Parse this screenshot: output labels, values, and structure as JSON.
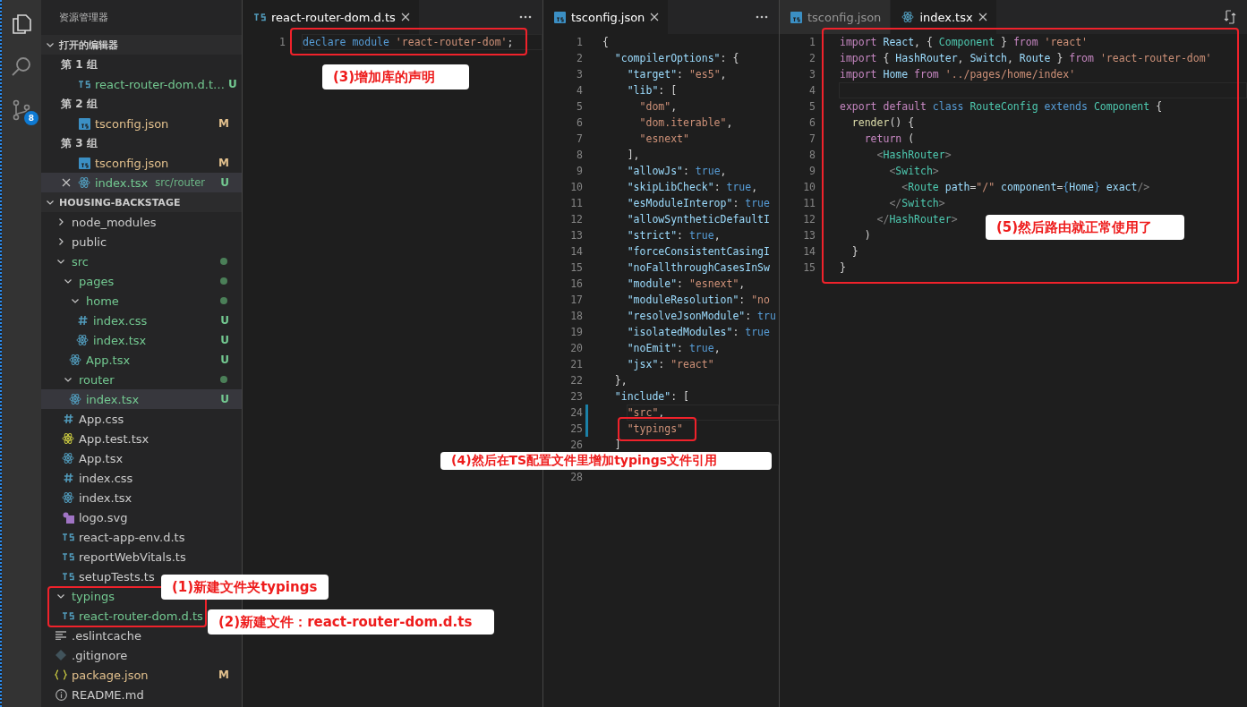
{
  "activity_bar": {
    "badge": "8"
  },
  "explorer": {
    "title": "资源管理器",
    "open_editors": {
      "title": "打开的编辑器",
      "expanded": true,
      "groups": [
        {
          "label": "第 1 组",
          "files": [
            {
              "name": "react-router-dom.d.t…",
              "kind": "ts",
              "color": "#73c991",
              "badge": "U",
              "selected": false
            }
          ]
        },
        {
          "label": "第 2 组",
          "files": [
            {
              "name": "tsconfig.json",
              "kind": "tsconfig",
              "color": "#e2c08d",
              "badge": "M",
              "selected": false
            }
          ]
        },
        {
          "label": "第 3 组",
          "files": [
            {
              "name": "tsconfig.json",
              "kind": "tsconfig",
              "color": "#e2c08d",
              "badge": "M",
              "selected": false
            },
            {
              "name": "index.tsx",
              "description": "src/router",
              "kind": "react",
              "color": "#73c991",
              "badge": "U",
              "selected": true
            }
          ]
        }
      ]
    },
    "project": {
      "title": "HOUSING-BACKSTAGE",
      "expanded": true,
      "tree": [
        {
          "name": "node_modules",
          "kind": "folder",
          "expanded": false,
          "color": "#cccccc",
          "selected": false
        },
        {
          "name": "public",
          "kind": "folder",
          "expanded": false,
          "color": "#cccccc",
          "selected": false
        },
        {
          "name": "src",
          "kind": "folder",
          "expanded": true,
          "color": "#73c991",
          "dot": true,
          "selected": false,
          "children": [
            {
              "name": "pages",
              "kind": "folder",
              "expanded": true,
              "color": "#73c991",
              "dot": true,
              "selected": false,
              "children": [
                {
                  "name": "home",
                  "kind": "folder",
                  "expanded": true,
                  "color": "#73c991",
                  "dot": true,
                  "selected": false,
                  "children": [
                    {
                      "name": "index.css",
                      "kind": "css",
                      "color": "#73c991",
                      "badge": "U",
                      "selected": false
                    },
                    {
                      "name": "index.tsx",
                      "kind": "react",
                      "color": "#73c991",
                      "badge": "U",
                      "selected": false
                    }
                  ]
                },
                {
                  "name": "App.tsx",
                  "kind": "react",
                  "color": "#73c991",
                  "badge": "U",
                  "selected": false
                }
              ]
            },
            {
              "name": "router",
              "kind": "folder",
              "expanded": true,
              "color": "#73c991",
              "dot": true,
              "selected": false,
              "children": [
                {
                  "name": "index.tsx",
                  "kind": "react",
                  "color": "#73c991",
                  "badge": "U",
                  "selected": true
                }
              ]
            },
            {
              "name": "App.css",
              "kind": "css",
              "color": "#cccccc",
              "selected": false
            },
            {
              "name": "App.test.tsx",
              "kind": "test",
              "color": "#cccccc",
              "selected": false
            },
            {
              "name": "App.tsx",
              "kind": "react",
              "color": "#cccccc",
              "selected": false
            },
            {
              "name": "index.css",
              "kind": "css",
              "color": "#cccccc",
              "selected": false
            },
            {
              "name": "index.tsx",
              "kind": "react",
              "color": "#cccccc",
              "selected": false
            },
            {
              "name": "logo.svg",
              "kind": "svg",
              "color": "#cccccc",
              "selected": false
            },
            {
              "name": "react-app-env.d.ts",
              "kind": "ts",
              "color": "#cccccc",
              "selected": false
            },
            {
              "name": "reportWebVitals.ts",
              "kind": "ts",
              "color": "#cccccc",
              "selected": false
            },
            {
              "name": "setupTests.ts",
              "kind": "ts",
              "color": "#cccccc",
              "selected": false
            }
          ]
        },
        {
          "name": "typings",
          "kind": "folder",
          "expanded": true,
          "color": "#73c991",
          "selected": false,
          "children": [
            {
              "name": "react-router-dom.d.ts",
              "kind": "ts",
              "color": "#73c991",
              "selected": false
            }
          ]
        },
        {
          "name": ".eslintcache",
          "kind": "lines",
          "color": "#cccccc",
          "selected": false
        },
        {
          "name": ".gitignore",
          "kind": "git",
          "color": "#cccccc",
          "selected": false
        },
        {
          "name": "package.json",
          "kind": "json",
          "color": "#e2c08d",
          "badge": "M",
          "selected": false
        },
        {
          "name": "README.md",
          "kind": "info",
          "color": "#cccccc",
          "selected": false
        }
      ]
    }
  },
  "editor_groups": [
    {
      "kind": "more",
      "tabs": [
        {
          "label": "react-router-dom.d.ts",
          "kind": "ts",
          "selected": true
        }
      ],
      "lines": [
        {
          "n": "1",
          "current": true,
          "tokens": [
            {
              "kind": "b",
              "text": "declare module "
            },
            {
              "kind": "s",
              "text": "'react-router-dom'"
            },
            {
              "kind": "p",
              "text": ";"
            }
          ]
        }
      ]
    },
    {
      "kind": "more",
      "tabs": [
        {
          "label": "tsconfig.json",
          "kind": "tsconfig",
          "selected": true
        }
      ],
      "lines": [
        {
          "n": "1",
          "tokens": [
            {
              "kind": "p",
              "text": "{"
            }
          ]
        },
        {
          "n": "2",
          "tokens": [
            {
              "kind": "k",
              "text": "  \"compilerOptions\""
            },
            {
              "kind": "p",
              "text": ": {"
            }
          ]
        },
        {
          "n": "3",
          "tokens": [
            {
              "kind": "k",
              "text": "    \"target\""
            },
            {
              "kind": "p",
              "text": ": "
            },
            {
              "kind": "s",
              "text": "\"es5\""
            },
            {
              "kind": "p",
              "text": ","
            }
          ]
        },
        {
          "n": "4",
          "tokens": [
            {
              "kind": "k",
              "text": "    \"lib\""
            },
            {
              "kind": "p",
              "text": ": ["
            }
          ]
        },
        {
          "n": "5",
          "tokens": [
            {
              "kind": "s",
              "text": "      \"dom\""
            },
            {
              "kind": "p",
              "text": ","
            }
          ]
        },
        {
          "n": "6",
          "tokens": [
            {
              "kind": "s",
              "text": "      \"dom.iterable\""
            },
            {
              "kind": "p",
              "text": ","
            }
          ]
        },
        {
          "n": "7",
          "tokens": [
            {
              "kind": "s",
              "text": "      \"esnext\""
            }
          ]
        },
        {
          "n": "8",
          "tokens": [
            {
              "kind": "p",
              "text": "    ],"
            }
          ]
        },
        {
          "n": "9",
          "tokens": [
            {
              "kind": "k",
              "text": "    \"allowJs\""
            },
            {
              "kind": "p",
              "text": ": "
            },
            {
              "kind": "b",
              "text": "true"
            },
            {
              "kind": "p",
              "text": ","
            }
          ]
        },
        {
          "n": "10",
          "tokens": [
            {
              "kind": "k",
              "text": "    \"skipLibCheck\""
            },
            {
              "kind": "p",
              "text": ": "
            },
            {
              "kind": "b",
              "text": "true"
            },
            {
              "kind": "p",
              "text": ","
            }
          ]
        },
        {
          "n": "11",
          "tokens": [
            {
              "kind": "k",
              "text": "    \"esModuleInterop\""
            },
            {
              "kind": "p",
              "text": ": "
            },
            {
              "kind": "b",
              "text": "true"
            }
          ]
        },
        {
          "n": "12",
          "tokens": [
            {
              "kind": "k",
              "text": "    \"allowSyntheticDefaultI"
            }
          ]
        },
        {
          "n": "13",
          "tokens": [
            {
              "kind": "k",
              "text": "    \"strict\""
            },
            {
              "kind": "p",
              "text": ": "
            },
            {
              "kind": "b",
              "text": "true"
            },
            {
              "kind": "p",
              "text": ","
            }
          ]
        },
        {
          "n": "14",
          "tokens": [
            {
              "kind": "k",
              "text": "    \"forceConsistentCasingI"
            }
          ]
        },
        {
          "n": "15",
          "tokens": [
            {
              "kind": "k",
              "text": "    \"noFallthroughCasesInSw"
            }
          ]
        },
        {
          "n": "16",
          "tokens": [
            {
              "kind": "k",
              "text": "    \"module\""
            },
            {
              "kind": "p",
              "text": ": "
            },
            {
              "kind": "s",
              "text": "\"esnext\""
            },
            {
              "kind": "p",
              "text": ","
            }
          ]
        },
        {
          "n": "17",
          "tokens": [
            {
              "kind": "k",
              "text": "    \"moduleResolution\""
            },
            {
              "kind": "p",
              "text": ": "
            },
            {
              "kind": "s",
              "text": "\"no"
            }
          ]
        },
        {
          "n": "18",
          "tokens": [
            {
              "kind": "k",
              "text": "    \"resolveJsonModule\""
            },
            {
              "kind": "p",
              "text": ": "
            },
            {
              "kind": "b",
              "text": "tru"
            }
          ]
        },
        {
          "n": "19",
          "tokens": [
            {
              "kind": "k",
              "text": "    \"isolatedModules\""
            },
            {
              "kind": "p",
              "text": ": "
            },
            {
              "kind": "b",
              "text": "true"
            }
          ]
        },
        {
          "n": "20",
          "tokens": [
            {
              "kind": "k",
              "text": "    \"noEmit\""
            },
            {
              "kind": "p",
              "text": ": "
            },
            {
              "kind": "b",
              "text": "true"
            },
            {
              "kind": "p",
              "text": ","
            }
          ]
        },
        {
          "n": "21",
          "tokens": [
            {
              "kind": "k",
              "text": "    \"jsx\""
            },
            {
              "kind": "p",
              "text": ": "
            },
            {
              "kind": "s",
              "text": "\"react\""
            }
          ]
        },
        {
          "n": "22",
          "tokens": [
            {
              "kind": "p",
              "text": "  },"
            }
          ]
        },
        {
          "n": "23",
          "tokens": [
            {
              "kind": "k",
              "text": "  \"include\""
            },
            {
              "kind": "p",
              "text": ": ["
            }
          ]
        },
        {
          "n": "24",
          "current": true,
          "changed": true,
          "tokens": [
            {
              "kind": "s",
              "text": "    \"src\""
            },
            {
              "kind": "p",
              "text": ","
            }
          ]
        },
        {
          "n": "25",
          "changed": true,
          "tokens": [
            {
              "kind": "s",
              "text": "    \"typings\""
            }
          ]
        },
        {
          "n": "26",
          "tokens": [
            {
              "kind": "p",
              "text": "  ]"
            }
          ]
        },
        {
          "n": "28"
        }
      ]
    },
    {
      "kind": "compare",
      "tabs": [
        {
          "label": "tsconfig.json",
          "kind": "tsconfig",
          "selected": false
        },
        {
          "label": "index.tsx",
          "kind": "react",
          "selected": true
        }
      ],
      "lines": [
        {
          "n": "1",
          "tokens": [
            {
              "kind": "m",
              "text": "import "
            },
            {
              "kind": "k",
              "text": "React"
            },
            {
              "kind": "p",
              "text": ", { "
            },
            {
              "kind": "c",
              "text": "Component"
            },
            {
              "kind": "p",
              "text": " } "
            },
            {
              "kind": "m",
              "text": "from "
            },
            {
              "kind": "s",
              "text": "'react'"
            }
          ]
        },
        {
          "n": "2",
          "tokens": [
            {
              "kind": "m",
              "text": "import "
            },
            {
              "kind": "p",
              "text": "{ "
            },
            {
              "kind": "k",
              "text": "HashRouter"
            },
            {
              "kind": "p",
              "text": ", "
            },
            {
              "kind": "k",
              "text": "Switch"
            },
            {
              "kind": "p",
              "text": ", "
            },
            {
              "kind": "k",
              "text": "Route"
            },
            {
              "kind": "p",
              "text": " } "
            },
            {
              "kind": "m",
              "text": "from "
            },
            {
              "kind": "s",
              "text": "'react-router-dom'"
            }
          ]
        },
        {
          "n": "3",
          "tokens": [
            {
              "kind": "m",
              "text": "import "
            },
            {
              "kind": "k",
              "text": "Home "
            },
            {
              "kind": "m",
              "text": "from "
            },
            {
              "kind": "s",
              "text": "'../pages/home/index'"
            }
          ]
        },
        {
          "n": "4",
          "current": true
        },
        {
          "n": "5",
          "tokens": [
            {
              "kind": "m",
              "text": "export default "
            },
            {
              "kind": "b",
              "text": "class "
            },
            {
              "kind": "c",
              "text": "RouteConfig "
            },
            {
              "kind": "b",
              "text": "extends "
            },
            {
              "kind": "c",
              "text": "Component "
            },
            {
              "kind": "p",
              "text": "{"
            }
          ]
        },
        {
          "n": "6",
          "tokens": [
            {
              "kind": "f",
              "text": "  render"
            },
            {
              "kind": "p",
              "text": "() {"
            }
          ]
        },
        {
          "n": "7",
          "tokens": [
            {
              "kind": "m",
              "text": "    return "
            },
            {
              "kind": "p",
              "text": "("
            }
          ]
        },
        {
          "n": "8",
          "tokens": [
            {
              "kind": "g",
              "text": "      <"
            },
            {
              "kind": "c",
              "text": "HashRouter"
            },
            {
              "kind": "g",
              "text": ">"
            }
          ]
        },
        {
          "n": "9",
          "tokens": [
            {
              "kind": "g",
              "text": "        <"
            },
            {
              "kind": "c",
              "text": "Switch"
            },
            {
              "kind": "g",
              "text": ">"
            }
          ]
        },
        {
          "n": "10",
          "tokens": [
            {
              "kind": "g",
              "text": "          <"
            },
            {
              "kind": "c",
              "text": "Route "
            },
            {
              "kind": "k",
              "text": "path"
            },
            {
              "kind": "p",
              "text": "="
            },
            {
              "kind": "s",
              "text": "\"/\" "
            },
            {
              "kind": "k",
              "text": "component"
            },
            {
              "kind": "p",
              "text": "="
            },
            {
              "kind": "b",
              "text": "{"
            },
            {
              "kind": "k",
              "text": "Home"
            },
            {
              "kind": "b",
              "text": "}"
            },
            {
              "kind": "k",
              "text": " exact"
            },
            {
              "kind": "g",
              "text": "/>"
            }
          ]
        },
        {
          "n": "11",
          "tokens": [
            {
              "kind": "g",
              "text": "        </"
            },
            {
              "kind": "c",
              "text": "Switch"
            },
            {
              "kind": "g",
              "text": ">"
            }
          ]
        },
        {
          "n": "12",
          "tokens": [
            {
              "kind": "g",
              "text": "      </"
            },
            {
              "kind": "c",
              "text": "HashRouter"
            },
            {
              "kind": "g",
              "text": ">"
            }
          ]
        },
        {
          "n": "13",
          "tokens": [
            {
              "kind": "p",
              "text": "    )"
            }
          ]
        },
        {
          "n": "14",
          "tokens": [
            {
              "kind": "p",
              "text": "  }"
            }
          ]
        },
        {
          "n": "15",
          "tokens": [
            {
              "kind": "p",
              "text": "}"
            }
          ]
        }
      ]
    }
  ],
  "annotations": [
    {
      "text": "(1)新建文件夹typings"
    },
    {
      "text": "(2)新建文件：react-router-dom.d.ts"
    },
    {
      "text": "(3)增加库的声明"
    },
    {
      "text": "(4)然后在TS配置文件里增加typings文件引用"
    },
    {
      "text": "(5)然后路由就正常使用了"
    }
  ]
}
